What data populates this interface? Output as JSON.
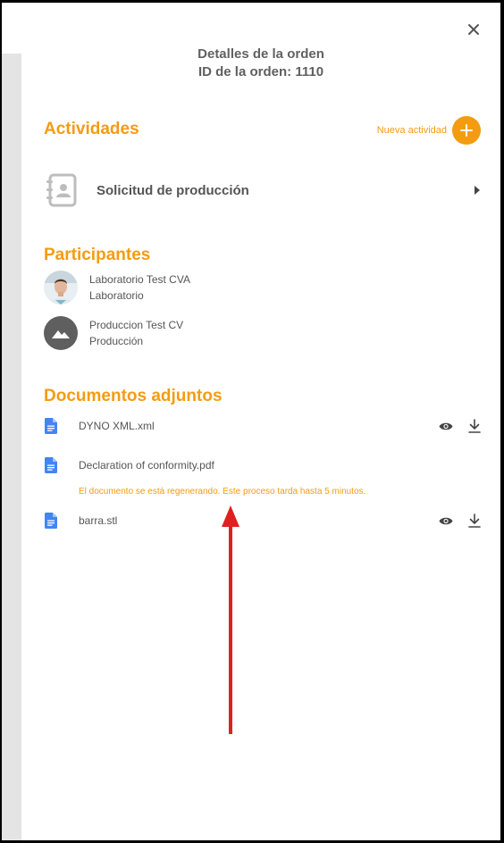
{
  "header": {
    "title": "Detalles de la orden",
    "order_id": "ID de la orden: 1110"
  },
  "activities": {
    "title": "Actividades",
    "new_label": "Nueva actividad",
    "items": [
      {
        "label": "Solicitud de producción"
      }
    ]
  },
  "participants": {
    "title": "Participantes",
    "items": [
      {
        "name": "Laboratorio Test CVA",
        "role": "Laboratorio",
        "avatar": "photo-avatar"
      },
      {
        "name": "Produccion Test CV",
        "role": "Producción",
        "avatar": "image-placeholder-icon"
      }
    ]
  },
  "documents": {
    "title": "Documentos adjuntos",
    "items": [
      {
        "name": "DYNO XML.xml",
        "actions": [
          "view",
          "download"
        ]
      },
      {
        "name": "Declaration of conformity.pdf",
        "actions": []
      },
      {
        "name": "barra.stl",
        "actions": [
          "view",
          "download"
        ]
      }
    ],
    "regenerating_notice": "El documento se está regenerando. Este proceso tarda hasta 5 minutos."
  },
  "colors": {
    "accent": "#f39c12",
    "doc_icon": "#4285f4",
    "annotation_arrow": "#e02020"
  }
}
